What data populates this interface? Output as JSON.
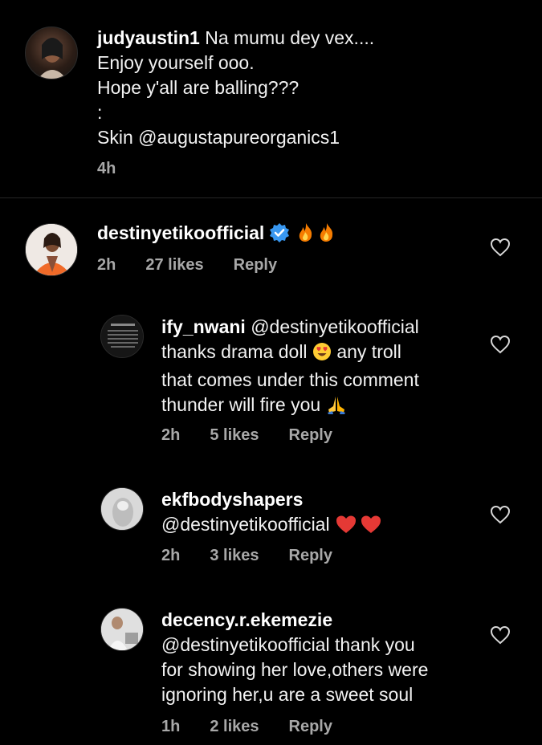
{
  "caption": {
    "username": "judyaustin1",
    "lines": [
      "Na mumu dey vex....",
      "Enjoy yourself ooo.",
      "Hope y'all are balling???",
      ":",
      "Skin @augustapureorganics1"
    ],
    "time": "4h"
  },
  "comments": [
    {
      "username": "destinyetikoofficial",
      "verified": true,
      "text": "",
      "time": "2h",
      "likes": "27 likes",
      "reply": "Reply"
    }
  ],
  "replies": [
    {
      "username": "ify_nwani",
      "lines": [
        "@destinyetikoofficial",
        "thanks drama doll",
        "any troll",
        "that comes under this comment",
        "thunder will fire you"
      ],
      "time": "2h",
      "likes": "5 likes",
      "reply": "Reply"
    },
    {
      "username": "ekfbodyshapers",
      "lines": [
        "@destinyetikoofficial"
      ],
      "time": "2h",
      "likes": "3 likes",
      "reply": "Reply"
    },
    {
      "username": "decency.r.ekemezie",
      "lines": [
        "@destinyetikoofficial thank you",
        "for showing her love,others were",
        "ignoring her,u are a sweet soul"
      ],
      "time": "1h",
      "likes": "2 likes",
      "reply": "Reply"
    }
  ],
  "colors": {
    "background": "#000000",
    "text": "#f5f5f5",
    "meta": "#a8a8a8",
    "verified": "#3897f0"
  }
}
